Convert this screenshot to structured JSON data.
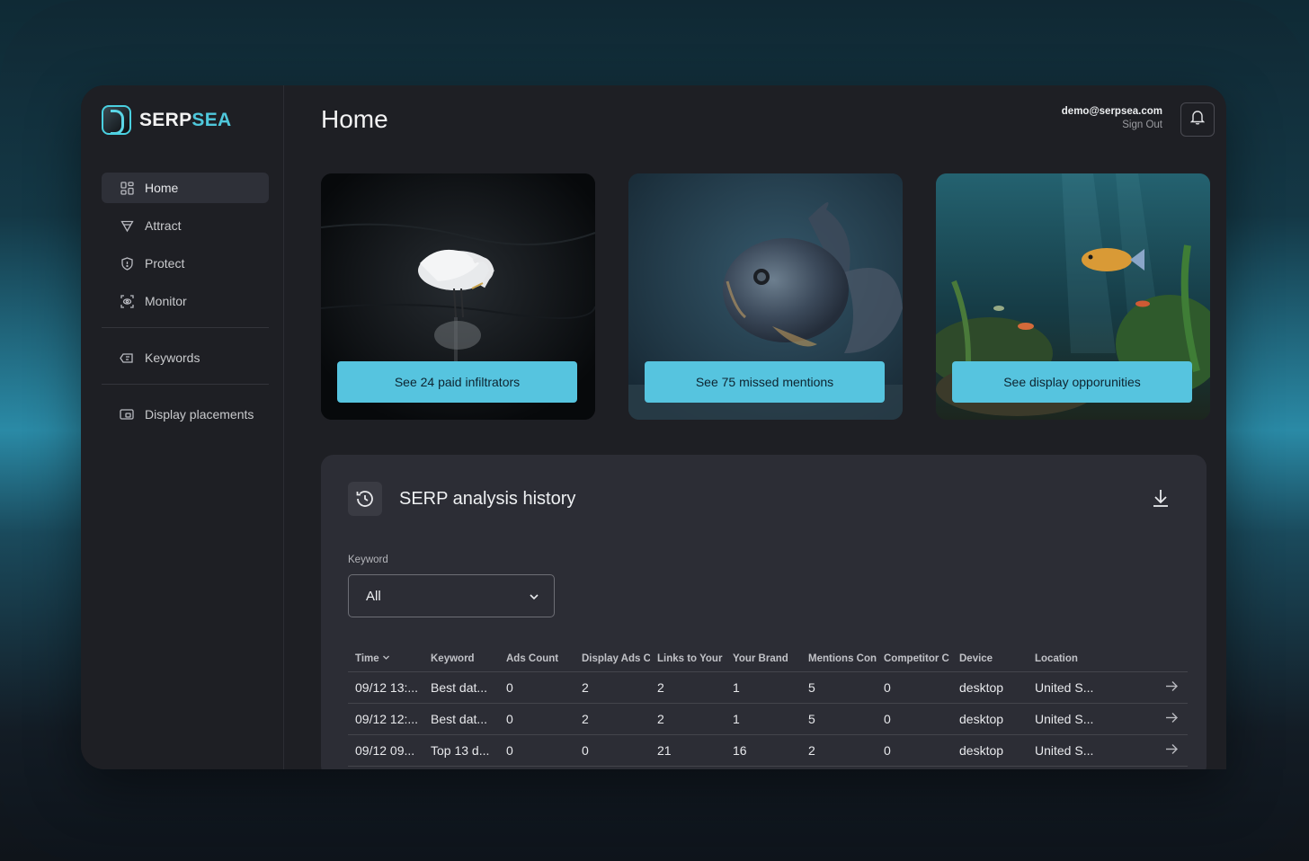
{
  "brand": {
    "name_part1": "SERP",
    "name_part2": "SEA"
  },
  "sidebar": {
    "items": [
      {
        "label": "Home",
        "icon": "grid-icon",
        "active": true
      },
      {
        "label": "Attract",
        "icon": "funnel-icon"
      },
      {
        "label": "Protect",
        "icon": "shield-icon"
      },
      {
        "label": "Monitor",
        "icon": "eye-icon"
      },
      {
        "label": "Keywords",
        "icon": "keyword-tag-icon"
      },
      {
        "label": "Display placements",
        "icon": "display-icon"
      }
    ]
  },
  "header": {
    "title": "Home",
    "user_email": "demo@serpsea.com",
    "sign_out": "Sign Out"
  },
  "cards": [
    {
      "cta": "See 24 paid infiltrators",
      "image": "egret-on-dark-water"
    },
    {
      "cta": "See 75 missed mentions",
      "image": "goldfish-closeup"
    },
    {
      "cta": "See display opporunities",
      "image": "aquarium-with-fish"
    }
  ],
  "history": {
    "title": "SERP analysis history",
    "keyword_label": "Keyword",
    "keyword_value": "All",
    "columns": [
      "Time",
      "Keyword",
      "Ads Count",
      "Display Ads C",
      "Links to Your I",
      "Your Brand",
      "Mentions Con",
      "Competitor C",
      "Device",
      "Location"
    ],
    "rows": [
      [
        "09/12 13:...",
        "Best dat...",
        "0",
        "2",
        "2",
        "1",
        "5",
        "0",
        "desktop",
        "United S..."
      ],
      [
        "09/12 12:...",
        "Best dat...",
        "0",
        "2",
        "2",
        "1",
        "5",
        "0",
        "desktop",
        "United S..."
      ],
      [
        "09/12 09...",
        "Top 13 d...",
        "0",
        "0",
        "21",
        "16",
        "2",
        "0",
        "desktop",
        "United S..."
      ]
    ]
  },
  "colors": {
    "accent": "#56c4df",
    "panel": "#2c2d35",
    "app_bg": "#1e1f24"
  }
}
